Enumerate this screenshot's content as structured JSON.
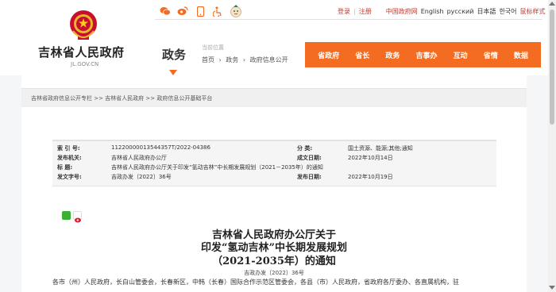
{
  "header": {
    "site_title": "吉林省人民政府",
    "site_domain": "JL.GOV.CN",
    "section": "政务",
    "location_label": "当前位置",
    "breadcrumb": [
      "首页",
      "›",
      "政务",
      "›",
      "政府信息公开"
    ],
    "top_links": [
      "登录",
      "|",
      "注册",
      "中国政府网",
      "English",
      "русский",
      "日本語",
      "한국어",
      "鼠标样式"
    ],
    "icons": [
      "weixin-icon",
      "weibo-icon",
      "phone-icon",
      "accessibility-icon",
      "mascot-icon"
    ]
  },
  "nav": [
    "省政府",
    "省长",
    "政务",
    "吉事办",
    "互动",
    "省情",
    "数据"
  ],
  "pathbar": "吉林省政府信息公开专栏 >> 吉林省人民政府 >> 政府信息公开基础平台",
  "meta": {
    "index_key": "索 引 号:",
    "index_val": "11220000013544357T/2022-04386",
    "category_key": "分    类:",
    "category_val": "国土资源、能源;其他;通知",
    "issuer_key": "发布机关:",
    "issuer_val": "吉林省人民政府办公厅",
    "written_key": "成文日期:",
    "written_val": "2022年10月14日",
    "title_key": "标    题:",
    "title_val": "吉林省人民政府办公厅关于印发“氢动吉林”中长期发展规划（2021－2035年）的通知",
    "docno_key": "发文字号:",
    "docno_val": "吉政办发〔2022〕36号",
    "pubdate_key": "发布日期:",
    "pubdate_val": "2022年10月19日"
  },
  "document": {
    "title_line1": "吉林省人民政府办公厅关于",
    "title_line2": "印发“氢动吉林”中长期发展规划",
    "title_line3": "（2021-2035年）的通知",
    "doc_number": "吉政办发〔2022〕36号",
    "body_start": "各市（州）人民政府，长白山管委会，长春新区，中韩（长春）国际合作示范区管委会，各县（市）人民政府，省政府各厅委办、各直属机构，驻"
  },
  "colors": {
    "accent": "#f36c21",
    "link_red": "#c0392b"
  }
}
